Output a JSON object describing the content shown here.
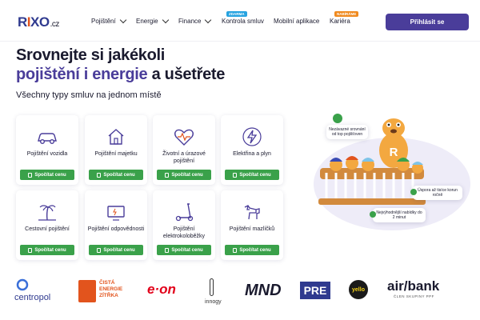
{
  "nav": {
    "logo_main": "R",
    "logo_o": "I",
    "logo_rest": "XO",
    "logo_tld": ".cz",
    "items": [
      {
        "label": "Pojištění"
      },
      {
        "label": "Energie"
      },
      {
        "label": "Finance"
      },
      {
        "label": "Kontrola smluv",
        "badge": "Zdarma"
      },
      {
        "label": "Mobilní aplikace"
      },
      {
        "label": "Kariéra",
        "badge": "Nabíráme"
      }
    ],
    "login_label": "Přihlásit se"
  },
  "hero": {
    "line1": "Srovnejte si jakékoli",
    "line2_accent": "pojištění i energie",
    "line2_rest": " a ušetřete",
    "subtitle": "Všechny typy smluv na jednom místě"
  },
  "products": [
    {
      "label": "Pojištění vozidla",
      "icon": "car-icon",
      "button": "Spočítat cenu"
    },
    {
      "label": "Pojištění majetku",
      "icon": "house-icon",
      "button": "Spočítat cenu"
    },
    {
      "label": "Životní a úrazové pojištění",
      "icon": "heart-pulse-icon",
      "button": "Spočítat cenu"
    },
    {
      "label": "Elektřina a plyn",
      "icon": "bolt-icon",
      "button": "Spočítat cenu"
    },
    {
      "label": "Cestovní pojištění",
      "icon": "palm-icon",
      "button": "Spočítat cenu"
    },
    {
      "label": "Pojištění odpovědnosti",
      "icon": "tv-icon",
      "button": "Spočítat cenu"
    },
    {
      "label": "Pojištění elektrokoloběžky",
      "icon": "scooter-icon",
      "button": "Spočítat cenu"
    },
    {
      "label": "Pojištění mazlíčků",
      "icon": "dog-icon",
      "button": "Spočítat cenu"
    }
  ],
  "bubbles": {
    "b1": "Nezávazné srovnání od top pojišťoven",
    "b2": "Úspora až tisíce korun ročně",
    "b3": "Nejvýhodnější nabídky do 2 minut"
  },
  "partners": {
    "centropol": "centropol",
    "cez_l1": "ČISTÁ",
    "cez_l2": "ENERGIE",
    "cez_l3": "ZÍTŘKA",
    "eon": "e·on",
    "innogy": "innogy",
    "mnd": "MND",
    "pre": "PRE",
    "yello": "yello",
    "airbank": "air/bank",
    "airbank_sub": "ČLEN SKUPINY PPF"
  },
  "colors": {
    "brand": "#4a3d9a",
    "green": "#3aa14a",
    "orange": "#e2541d"
  }
}
